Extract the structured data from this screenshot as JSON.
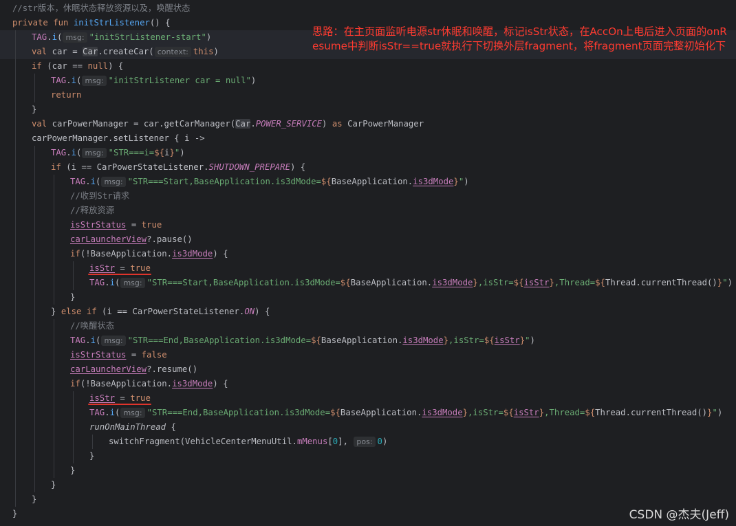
{
  "annotation": "思路：在主页面监听电源str休眠和唤醒，标记isStr状态，在AccOn上电后进入页面的onResume中判断isStr==true就执行下切换外层fragment，将fragment页面完整初始化下",
  "watermark": "CSDN @杰夫(Jeff)",
  "code_lines": [
    {
      "indent": 0,
      "tokens": [
        {
          "t": "//str版本，休眠状态释放资源以及，唤醒状态",
          "c": "cmt"
        }
      ]
    },
    {
      "indent": 0,
      "tokens": [
        {
          "t": "private fun ",
          "c": "kw"
        },
        {
          "t": "initStrListener",
          "c": "fn"
        },
        {
          "t": "() {"
        }
      ]
    },
    {
      "indent": 1,
      "hl": true,
      "tokens": [
        {
          "t": "TAG",
          "c": "fld"
        },
        {
          "t": "."
        },
        {
          "t": "i",
          "c": "fn"
        },
        {
          "t": "("
        },
        {
          "t": "msg:",
          "c": "hint"
        },
        {
          "t": "\"initStrListener-start\"",
          "c": "str"
        },
        {
          "t": ")"
        }
      ]
    },
    {
      "indent": 1,
      "hl": true,
      "tokens": [
        {
          "t": "val ",
          "c": "kw"
        },
        {
          "t": "car = "
        },
        {
          "t": "Car",
          "c": "box"
        },
        {
          "t": ".createCar("
        },
        {
          "t": "context:",
          "c": "hint"
        },
        {
          "t": "this",
          "c": "kw"
        },
        {
          "t": ")"
        }
      ]
    },
    {
      "indent": 1,
      "tokens": [
        {
          "t": "if ",
          "c": "kw"
        },
        {
          "t": "(car == "
        },
        {
          "t": "null",
          "c": "kw"
        },
        {
          "t": ") {"
        }
      ]
    },
    {
      "indent": 2,
      "tokens": [
        {
          "t": "TAG",
          "c": "fld"
        },
        {
          "t": "."
        },
        {
          "t": "i",
          "c": "fn"
        },
        {
          "t": "("
        },
        {
          "t": "msg:",
          "c": "hint"
        },
        {
          "t": "\"initStrListener car = null\"",
          "c": "str"
        },
        {
          "t": ")"
        }
      ]
    },
    {
      "indent": 2,
      "tokens": [
        {
          "t": "return",
          "c": "kw"
        }
      ]
    },
    {
      "indent": 1,
      "tokens": [
        {
          "t": "}"
        }
      ]
    },
    {
      "indent": 1,
      "tokens": [
        {
          "t": "val ",
          "c": "kw"
        },
        {
          "t": "carPowerManager = car.getCarManager("
        },
        {
          "t": "Car",
          "c": "box"
        },
        {
          "t": "."
        },
        {
          "t": "POWER_SERVICE",
          "c": "fld-it"
        },
        {
          "t": ") "
        },
        {
          "t": "as ",
          "c": "kw"
        },
        {
          "t": "CarPowerManager"
        }
      ]
    },
    {
      "indent": 1,
      "tokens": [
        {
          "t": "carPowerManager.setListener { i ->"
        }
      ]
    },
    {
      "indent": 2,
      "tokens": [
        {
          "t": "TAG",
          "c": "fld"
        },
        {
          "t": "."
        },
        {
          "t": "i",
          "c": "fn"
        },
        {
          "t": "("
        },
        {
          "t": "msg:",
          "c": "hint"
        },
        {
          "t": "\"STR===i=",
          "c": "str"
        },
        {
          "t": "${",
          "c": "tpl"
        },
        {
          "t": "i"
        },
        {
          "t": "}",
          "c": "tpl"
        },
        {
          "t": "\"",
          "c": "str"
        },
        {
          "t": ")"
        }
      ]
    },
    {
      "indent": 2,
      "tokens": [
        {
          "t": "if ",
          "c": "kw"
        },
        {
          "t": "(i == CarPowerStateListener."
        },
        {
          "t": "SHUTDOWN_PREPARE",
          "c": "fld-it"
        },
        {
          "t": ") {"
        }
      ]
    },
    {
      "indent": 3,
      "tokens": [
        {
          "t": "TAG",
          "c": "fld"
        },
        {
          "t": "."
        },
        {
          "t": "i",
          "c": "fn"
        },
        {
          "t": "("
        },
        {
          "t": "msg:",
          "c": "hint"
        },
        {
          "t": "\"STR===Start,BaseApplication.is3dMode=",
          "c": "str"
        },
        {
          "t": "${",
          "c": "tpl"
        },
        {
          "t": "BaseApplication."
        },
        {
          "t": "is3dMode",
          "c": "fld-ul"
        },
        {
          "t": "}",
          "c": "tpl"
        },
        {
          "t": "\"",
          "c": "str"
        },
        {
          "t": ")"
        }
      ]
    },
    {
      "indent": 3,
      "tokens": [
        {
          "t": "//收到Str请求",
          "c": "cmt"
        }
      ]
    },
    {
      "indent": 3,
      "tokens": [
        {
          "t": "//释放资源",
          "c": "cmt"
        }
      ]
    },
    {
      "indent": 3,
      "tokens": [
        {
          "t": "isStrStatus",
          "c": "fld-ul"
        },
        {
          "t": " = "
        },
        {
          "t": "true",
          "c": "kw"
        }
      ]
    },
    {
      "indent": 3,
      "tokens": [
        {
          "t": "carLauncherView",
          "c": "fld-ul"
        },
        {
          "t": "?.pause()"
        }
      ]
    },
    {
      "indent": 3,
      "tokens": [
        {
          "t": "if",
          "c": "kw"
        },
        {
          "t": "(!BaseApplication."
        },
        {
          "t": "is3dMode",
          "c": "fld-ul"
        },
        {
          "t": ") {"
        }
      ]
    },
    {
      "indent": 4,
      "redline": true,
      "tokens": [
        {
          "t": "isStr",
          "c": "fld-ul"
        },
        {
          "t": " = "
        },
        {
          "t": "true",
          "c": "kw"
        }
      ]
    },
    {
      "indent": 4,
      "tokens": [
        {
          "t": "TAG",
          "c": "fld"
        },
        {
          "t": "."
        },
        {
          "t": "i",
          "c": "fn"
        },
        {
          "t": "("
        },
        {
          "t": "msg:",
          "c": "hint"
        },
        {
          "t": "\"STR===Start,BaseApplication.is3dMode=",
          "c": "str"
        },
        {
          "t": "${",
          "c": "tpl"
        },
        {
          "t": "BaseApplication."
        },
        {
          "t": "is3dMode",
          "c": "fld-ul"
        },
        {
          "t": "}",
          "c": "tpl"
        },
        {
          "t": ",isStr=",
          "c": "str"
        },
        {
          "t": "${",
          "c": "tpl"
        },
        {
          "t": "isStr",
          "c": "fld-ul"
        },
        {
          "t": "}",
          "c": "tpl"
        },
        {
          "t": ",Thread=",
          "c": "str"
        },
        {
          "t": "${",
          "c": "tpl"
        },
        {
          "t": "Thread.currentThread()"
        },
        {
          "t": "}",
          "c": "tpl"
        },
        {
          "t": "\"",
          "c": "str"
        },
        {
          "t": ")"
        }
      ]
    },
    {
      "indent": 3,
      "tokens": [
        {
          "t": "}"
        }
      ]
    },
    {
      "indent": 2,
      "tokens": [
        {
          "t": "} "
        },
        {
          "t": "else if ",
          "c": "kw"
        },
        {
          "t": "(i == CarPowerStateListener."
        },
        {
          "t": "ON",
          "c": "fld-it"
        },
        {
          "t": ") {"
        }
      ]
    },
    {
      "indent": 3,
      "tokens": [
        {
          "t": "//唤醒状态",
          "c": "cmt"
        }
      ]
    },
    {
      "indent": 3,
      "tokens": [
        {
          "t": "TAG",
          "c": "fld"
        },
        {
          "t": "."
        },
        {
          "t": "i",
          "c": "fn"
        },
        {
          "t": "("
        },
        {
          "t": "msg:",
          "c": "hint"
        },
        {
          "t": "\"STR===End,BaseApplication.is3dMode=",
          "c": "str"
        },
        {
          "t": "${",
          "c": "tpl"
        },
        {
          "t": "BaseApplication."
        },
        {
          "t": "is3dMode",
          "c": "fld-ul"
        },
        {
          "t": "}",
          "c": "tpl"
        },
        {
          "t": ",isStr=",
          "c": "str"
        },
        {
          "t": "${",
          "c": "tpl"
        },
        {
          "t": "isStr",
          "c": "fld-ul"
        },
        {
          "t": "}",
          "c": "tpl"
        },
        {
          "t": "\"",
          "c": "str"
        },
        {
          "t": ")"
        }
      ]
    },
    {
      "indent": 3,
      "tokens": [
        {
          "t": "isStrStatus",
          "c": "fld-ul"
        },
        {
          "t": " = "
        },
        {
          "t": "false",
          "c": "kw"
        }
      ]
    },
    {
      "indent": 3,
      "tokens": [
        {
          "t": "carLauncherView",
          "c": "fld-ul"
        },
        {
          "t": "?.resume()"
        }
      ]
    },
    {
      "indent": 3,
      "tokens": [
        {
          "t": "if",
          "c": "kw"
        },
        {
          "t": "(!BaseApplication."
        },
        {
          "t": "is3dMode",
          "c": "fld-ul"
        },
        {
          "t": ") {"
        }
      ]
    },
    {
      "indent": 4,
      "redline": true,
      "tokens": [
        {
          "t": "isStr",
          "c": "fld-ul"
        },
        {
          "t": " = "
        },
        {
          "t": "true",
          "c": "kw"
        }
      ]
    },
    {
      "indent": 4,
      "tokens": [
        {
          "t": "TAG",
          "c": "fld"
        },
        {
          "t": "."
        },
        {
          "t": "i",
          "c": "fn"
        },
        {
          "t": "("
        },
        {
          "t": "msg:",
          "c": "hint"
        },
        {
          "t": "\"STR===End,BaseApplication.is3dMode=",
          "c": "str"
        },
        {
          "t": "${",
          "c": "tpl"
        },
        {
          "t": "BaseApplication."
        },
        {
          "t": "is3dMode",
          "c": "fld-ul"
        },
        {
          "t": "}",
          "c": "tpl"
        },
        {
          "t": ",isStr=",
          "c": "str"
        },
        {
          "t": "${",
          "c": "tpl"
        },
        {
          "t": "isStr",
          "c": "fld-ul"
        },
        {
          "t": "}",
          "c": "tpl"
        },
        {
          "t": ",Thread=",
          "c": "str"
        },
        {
          "t": "${",
          "c": "tpl"
        },
        {
          "t": "Thread.currentThread()"
        },
        {
          "t": "}",
          "c": "tpl"
        },
        {
          "t": "\"",
          "c": "str"
        },
        {
          "t": ")"
        }
      ]
    },
    {
      "indent": 4,
      "tokens": [
        {
          "t": "runOnMainThread",
          "c": "it"
        },
        {
          "t": " {"
        }
      ]
    },
    {
      "indent": 5,
      "tokens": [
        {
          "t": "switchFragment(VehicleCenterMenuUtil."
        },
        {
          "t": "mMenus",
          "c": "fld"
        },
        {
          "t": "["
        },
        {
          "t": "0",
          "c": "num"
        },
        {
          "t": "], "
        },
        {
          "t": "pos:",
          "c": "hint"
        },
        {
          "t": "0",
          "c": "num"
        },
        {
          "t": ")"
        }
      ]
    },
    {
      "indent": 4,
      "tokens": [
        {
          "t": "}"
        }
      ]
    },
    {
      "indent": 3,
      "tokens": [
        {
          "t": "}"
        }
      ]
    },
    {
      "indent": 2,
      "tokens": [
        {
          "t": "}"
        }
      ]
    },
    {
      "indent": 1,
      "tokens": [
        {
          "t": "}"
        }
      ]
    },
    {
      "indent": 0,
      "tokens": [
        {
          "t": "}"
        }
      ]
    }
  ]
}
